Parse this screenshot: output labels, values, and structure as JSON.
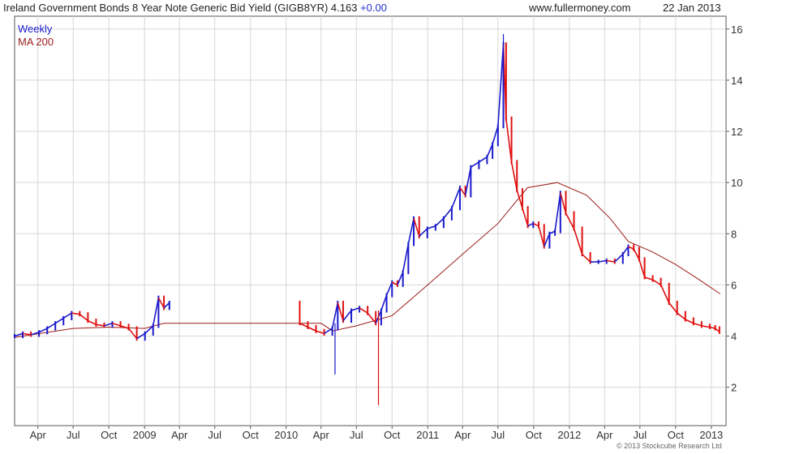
{
  "header": {
    "title": "Ireland Government Bonds 8 Year Note Generic Bid Yield (GIGB8YR) 4.163",
    "change": "+0.00",
    "source": "www.fullermoney.com",
    "date": "22 Jan 2013"
  },
  "footer": {
    "copyright": "© 2013 Stockcube Research Ltd"
  },
  "colors": {
    "up": "#1a1acc",
    "down": "#e01010",
    "ma": "#9b1b1b",
    "grid": "#d7d7d7",
    "axis": "#333333"
  },
  "chart_data": {
    "type": "line",
    "legend": [
      "Weekly",
      "MA 200"
    ],
    "y_ticks": [
      2,
      4,
      6,
      8,
      10,
      12,
      14,
      16
    ],
    "ylim": [
      0.5,
      16.5
    ],
    "x_ticks": [
      "Apr",
      "Jul",
      "Oct",
      "2009",
      "Apr",
      "Jul",
      "Oct",
      "2010",
      "Apr",
      "Jul",
      "Oct",
      "2011",
      "Apr",
      "Jul",
      "Oct",
      "2012",
      "Apr",
      "Jul",
      "Oct",
      "2013"
    ],
    "x_tick_dates": [
      "2008-04-01",
      "2008-07-01",
      "2008-10-01",
      "2009-01-01",
      "2009-04-01",
      "2009-07-01",
      "2009-10-01",
      "2010-01-01",
      "2010-04-01",
      "2010-07-01",
      "2010-10-01",
      "2011-01-01",
      "2011-04-01",
      "2011-07-01",
      "2011-10-01",
      "2012-01-01",
      "2012-04-01",
      "2012-07-01",
      "2012-10-01",
      "2013-01-01"
    ],
    "xlim": [
      "2008-02-01",
      "2013-02-08"
    ],
    "series": [
      {
        "name": "Weekly",
        "kind": "candlestick",
        "points": [
          {
            "date": "2008-02-01",
            "close": 4.0
          },
          {
            "date": "2008-02-22",
            "close": 4.1
          },
          {
            "date": "2008-03-14",
            "close": 4.05
          },
          {
            "date": "2008-04-04",
            "close": 4.15
          },
          {
            "date": "2008-04-25",
            "close": 4.3
          },
          {
            "date": "2008-05-16",
            "close": 4.5
          },
          {
            "date": "2008-06-06",
            "close": 4.7
          },
          {
            "date": "2008-06-27",
            "close": 4.9
          },
          {
            "date": "2008-07-18",
            "close": 4.85
          },
          {
            "date": "2008-08-08",
            "close": 4.6
          },
          {
            "date": "2008-08-29",
            "close": 4.45
          },
          {
            "date": "2008-09-19",
            "close": 4.4
          },
          {
            "date": "2008-10-10",
            "close": 4.5
          },
          {
            "date": "2008-10-31",
            "close": 4.4
          },
          {
            "date": "2008-11-21",
            "close": 4.3
          },
          {
            "date": "2008-12-12",
            "close": 3.9
          },
          {
            "date": "2009-01-02",
            "close": 4.1
          },
          {
            "date": "2009-01-23",
            "close": 4.4
          },
          {
            "date": "2009-02-06",
            "close": 5.5
          },
          {
            "date": "2009-02-20",
            "close": 5.1
          },
          {
            "date": "2009-03-06",
            "close": 5.3
          },
          {
            "date": "2010-02-05",
            "close": 4.5
          },
          {
            "date": "2010-02-26",
            "close": 4.35
          },
          {
            "date": "2010-03-19",
            "close": 4.2
          },
          {
            "date": "2010-04-09",
            "close": 4.1
          },
          {
            "date": "2010-04-30",
            "close": 4.3
          },
          {
            "date": "2010-05-14",
            "close": 5.3
          },
          {
            "date": "2010-05-28",
            "close": 4.6
          },
          {
            "date": "2010-06-18",
            "close": 5.0
          },
          {
            "date": "2010-07-09",
            "close": 5.1
          },
          {
            "date": "2010-07-30",
            "close": 4.9
          },
          {
            "date": "2010-08-20",
            "close": 4.5
          },
          {
            "date": "2010-09-03",
            "close": 5.0
          },
          {
            "date": "2010-09-17",
            "close": 5.6
          },
          {
            "date": "2010-10-01",
            "close": 6.1
          },
          {
            "date": "2010-10-15",
            "close": 6.0
          },
          {
            "date": "2010-10-29",
            "close": 6.5
          },
          {
            "date": "2010-11-12",
            "close": 7.6
          },
          {
            "date": "2010-11-26",
            "close": 8.6
          },
          {
            "date": "2010-12-10",
            "close": 7.9
          },
          {
            "date": "2010-12-31",
            "close": 8.2
          },
          {
            "date": "2011-01-21",
            "close": 8.3
          },
          {
            "date": "2011-02-11",
            "close": 8.6
          },
          {
            "date": "2011-03-04",
            "close": 9.0
          },
          {
            "date": "2011-03-25",
            "close": 9.8
          },
          {
            "date": "2011-04-08",
            "close": 9.5
          },
          {
            "date": "2011-04-22",
            "close": 10.6
          },
          {
            "date": "2011-05-13",
            "close": 10.8
          },
          {
            "date": "2011-06-03",
            "close": 11.0
          },
          {
            "date": "2011-06-17",
            "close": 11.5
          },
          {
            "date": "2011-07-01",
            "close": 12.2
          },
          {
            "date": "2011-07-15",
            "close": 15.4
          },
          {
            "date": "2011-07-22",
            "close": 12.5
          },
          {
            "date": "2011-08-05",
            "close": 10.8
          },
          {
            "date": "2011-08-19",
            "close": 9.7
          },
          {
            "date": "2011-09-02",
            "close": 9.0
          },
          {
            "date": "2011-09-16",
            "close": 8.3
          },
          {
            "date": "2011-09-30",
            "close": 8.4
          },
          {
            "date": "2011-10-14",
            "close": 8.3
          },
          {
            "date": "2011-10-28",
            "close": 7.5
          },
          {
            "date": "2011-11-11",
            "close": 8.0
          },
          {
            "date": "2011-11-25",
            "close": 8.1
          },
          {
            "date": "2011-12-09",
            "close": 9.6
          },
          {
            "date": "2011-12-23",
            "close": 8.8
          },
          {
            "date": "2012-01-13",
            "close": 8.2
          },
          {
            "date": "2012-02-03",
            "close": 7.2
          },
          {
            "date": "2012-02-24",
            "close": 6.9
          },
          {
            "date": "2012-03-16",
            "close": 6.9
          },
          {
            "date": "2012-04-06",
            "close": 6.95
          },
          {
            "date": "2012-04-27",
            "close": 6.9
          },
          {
            "date": "2012-05-18",
            "close": 7.2
          },
          {
            "date": "2012-06-01",
            "close": 7.5
          },
          {
            "date": "2012-06-15",
            "close": 7.4
          },
          {
            "date": "2012-06-29",
            "close": 7.0
          },
          {
            "date": "2012-07-13",
            "close": 6.3
          },
          {
            "date": "2012-08-03",
            "close": 6.2
          },
          {
            "date": "2012-08-24",
            "close": 6.0
          },
          {
            "date": "2012-09-14",
            "close": 5.3
          },
          {
            "date": "2012-10-05",
            "close": 4.9
          },
          {
            "date": "2012-10-26",
            "close": 4.65
          },
          {
            "date": "2012-11-16",
            "close": 4.5
          },
          {
            "date": "2012-12-07",
            "close": 4.4
          },
          {
            "date": "2012-12-28",
            "close": 4.35
          },
          {
            "date": "2013-01-11",
            "close": 4.3
          },
          {
            "date": "2013-01-22",
            "close": 4.163
          }
        ],
        "spikes": [
          {
            "date": "2010-05-07",
            "low": 2.5,
            "high": 4.5
          },
          {
            "date": "2010-08-27",
            "low": 1.3,
            "high": 5.0
          },
          {
            "date": "2011-07-15",
            "low": 12.5,
            "high": 15.8
          }
        ]
      },
      {
        "name": "MA 200",
        "kind": "line",
        "points": [
          {
            "date": "2008-02-01",
            "value": 3.95
          },
          {
            "date": "2008-07-01",
            "value": 4.3
          },
          {
            "date": "2008-10-01",
            "value": 4.35
          },
          {
            "date": "2009-01-01",
            "value": 4.3
          },
          {
            "date": "2009-02-20",
            "value": 4.5
          },
          {
            "date": "2010-04-01",
            "value": 4.5
          },
          {
            "date": "2010-05-01",
            "value": 4.2
          },
          {
            "date": "2010-07-01",
            "value": 4.4
          },
          {
            "date": "2010-10-01",
            "value": 4.8
          },
          {
            "date": "2011-01-01",
            "value": 6.0
          },
          {
            "date": "2011-04-01",
            "value": 7.2
          },
          {
            "date": "2011-07-01",
            "value": 8.4
          },
          {
            "date": "2011-09-15",
            "value": 9.8
          },
          {
            "date": "2011-12-01",
            "value": 10.0
          },
          {
            "date": "2012-02-15",
            "value": 9.5
          },
          {
            "date": "2012-04-15",
            "value": 8.6
          },
          {
            "date": "2012-06-01",
            "value": 7.7
          },
          {
            "date": "2012-08-01",
            "value": 7.3
          },
          {
            "date": "2012-10-01",
            "value": 6.8
          },
          {
            "date": "2012-12-01",
            "value": 6.2
          },
          {
            "date": "2013-01-24",
            "value": 5.65
          }
        ]
      }
    ]
  }
}
